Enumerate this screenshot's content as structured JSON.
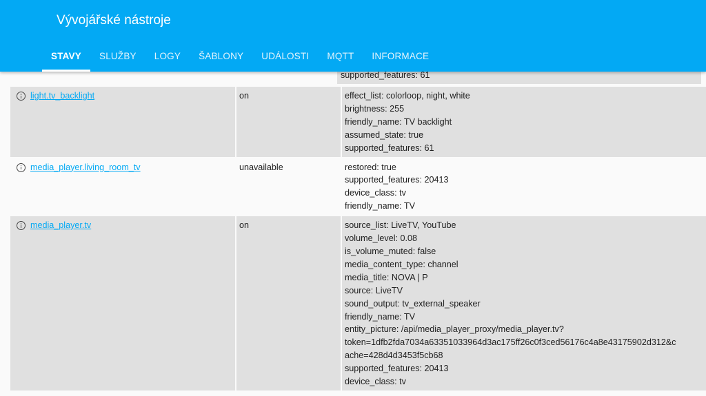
{
  "header": {
    "title": "Vývojářské nástroje",
    "tabs": [
      {
        "label": "STAVY",
        "active": true
      },
      {
        "label": "SLUŽBY"
      },
      {
        "label": "LOGY"
      },
      {
        "label": "ŠABLONY"
      },
      {
        "label": "UDÁLOSTI"
      },
      {
        "label": "MQTT"
      },
      {
        "label": "INFORMACE"
      }
    ],
    "accent_color": "#03a9f4"
  },
  "partial_row": {
    "attributes": [
      "supported_features: 61"
    ]
  },
  "rows": [
    {
      "entity": "light.tv_backlight",
      "state": "on",
      "attributes": [
        "effect_list: colorloop, night, white",
        "brightness: 255",
        "friendly_name: TV backlight",
        "assumed_state: true",
        "supported_features: 61"
      ]
    },
    {
      "entity": "media_player.living_room_tv",
      "state": "unavailable",
      "attributes": [
        "restored: true",
        "supported_features: 20413",
        "device_class: tv",
        "friendly_name: TV"
      ]
    },
    {
      "entity": "media_player.tv",
      "state": "on",
      "attributes": [
        "source_list: LiveTV, YouTube",
        "volume_level: 0.08",
        "is_volume_muted: false",
        "media_content_type: channel",
        "media_title: NOVA | P",
        "source: LiveTV",
        "sound_output: tv_external_speaker",
        "friendly_name: TV",
        "entity_picture: /api/media_player_proxy/media_player.tv?",
        "token=1dfb2fda7034a63351033964d3ac175ff26c0f3ced56176c4a8e43175902d312&c",
        "ache=428d4d3453f5cb68",
        "supported_features: 20413",
        "device_class: tv"
      ]
    }
  ]
}
